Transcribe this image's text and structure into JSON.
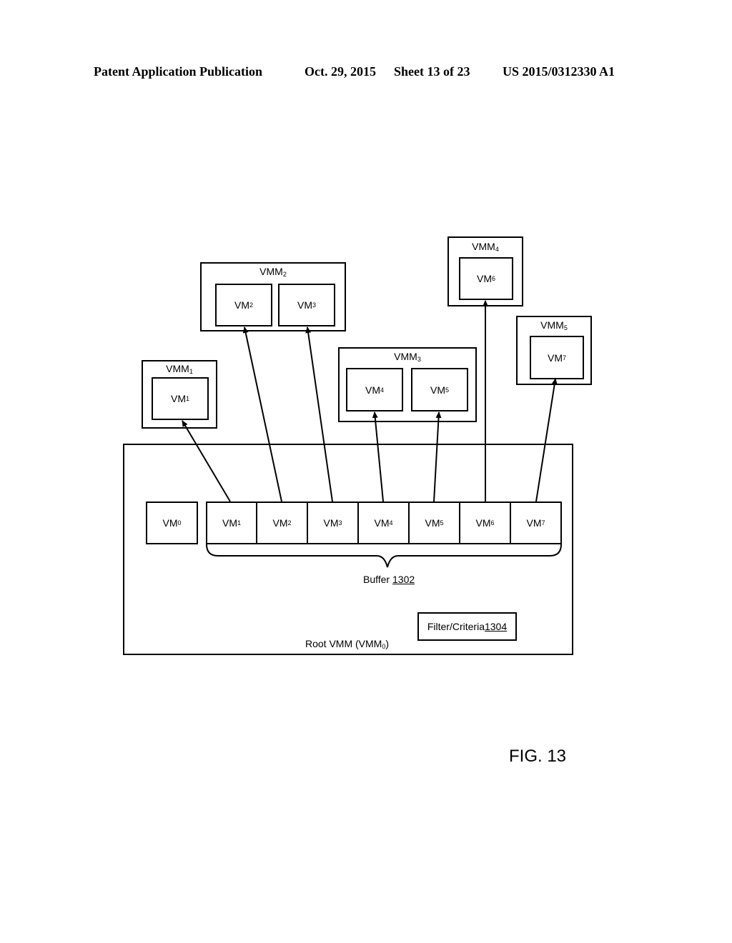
{
  "header": {
    "publication": "Patent Application Publication",
    "date": "Oct. 29, 2015",
    "sheet": "Sheet 13 of 23",
    "number": "US 2015/0312330 A1"
  },
  "root": {
    "label": "Root VMM (VMM",
    "label_sub": "0",
    "label_end": ")",
    "vm0": {
      "base": "VM",
      "sub": "0"
    },
    "buffer": {
      "cells": [
        {
          "base": "VM",
          "sub": "1"
        },
        {
          "base": "VM",
          "sub": "2"
        },
        {
          "base": "VM",
          "sub": "3"
        },
        {
          "base": "VM",
          "sub": "4"
        },
        {
          "base": "VM",
          "sub": "5"
        },
        {
          "base": "VM",
          "sub": "6"
        },
        {
          "base": "VM",
          "sub": "7"
        }
      ],
      "label": "Buffer ",
      "ref": "1302"
    },
    "filter": {
      "label": "Filter/Criteria ",
      "ref": "1304"
    }
  },
  "vmms": [
    {
      "base": "VMM",
      "sub": "1",
      "vms": [
        {
          "base": "VM",
          "sub": "1"
        }
      ]
    },
    {
      "base": "VMM",
      "sub": "2",
      "vms": [
        {
          "base": "VM",
          "sub": "2"
        },
        {
          "base": "VM",
          "sub": "3"
        }
      ]
    },
    {
      "base": "VMM",
      "sub": "3",
      "vms": [
        {
          "base": "VM",
          "sub": "4"
        },
        {
          "base": "VM",
          "sub": "5"
        }
      ]
    },
    {
      "base": "VMM",
      "sub": "4",
      "vms": [
        {
          "base": "VM",
          "sub": "6"
        }
      ]
    },
    {
      "base": "VMM",
      "sub": "5",
      "vms": [
        {
          "base": "VM",
          "sub": "7"
        }
      ]
    }
  ],
  "figure_label": "FIG. 13"
}
